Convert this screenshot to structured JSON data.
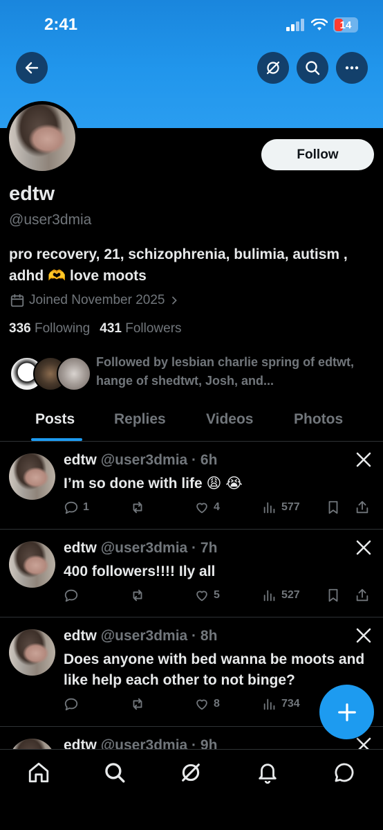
{
  "status_bar": {
    "time": "2:41",
    "battery": "14"
  },
  "profile": {
    "name": "edtw",
    "handle": "@user3dmia",
    "bio": "pro recovery, 21, schizophrenia, bulimia, autism , adhd 🫶 love moots",
    "joined": "Joined November 2025",
    "following_count": "336",
    "following_label": "Following",
    "followers_count": "431",
    "followers_label": "Followers",
    "followed_by": "Followed by lesbian charlie spring of edtwt, hange of shedtwt, Josh, and...",
    "follow_label": "Follow"
  },
  "tabs": [
    {
      "label": "Posts",
      "active": true
    },
    {
      "label": "Replies",
      "active": false
    },
    {
      "label": "Videos",
      "active": false
    },
    {
      "label": "Photos",
      "active": false
    }
  ],
  "posts": [
    {
      "name": "edtw",
      "handle": "@user3dmia",
      "time": "6h",
      "text": "I’m so done with life 😩 😭",
      "replies": "1",
      "reposts": "",
      "likes": "4",
      "views": "577"
    },
    {
      "name": "edtw",
      "handle": "@user3dmia",
      "time": "7h",
      "text": "400 followers!!!! Ily all",
      "replies": "",
      "reposts": "",
      "likes": "5",
      "views": "527"
    },
    {
      "name": "edtw",
      "handle": "@user3dmia",
      "time": "8h",
      "text": "Does anyone with bed wanna be moots and like help each other to not binge?",
      "replies": "",
      "reposts": "",
      "likes": "8",
      "views": "734"
    },
    {
      "name": "edtw",
      "handle": "@user3dmia",
      "time": "9h"
    }
  ],
  "colors": {
    "accent": "#1d9bf0",
    "banner": "#2196ec",
    "background": "#000000",
    "secondary_text": "#71767b"
  },
  "icons": {
    "back": "arrow-left-icon",
    "grok": "grok-icon",
    "search": "search-icon",
    "more": "more-icon",
    "calendar": "calendar-icon",
    "chevron": "chevron-right-icon",
    "x_logo": "x-logo-icon",
    "reply": "reply-icon",
    "repost": "repost-icon",
    "like": "heart-icon",
    "views": "views-icon",
    "bookmark": "bookmark-icon",
    "share": "share-icon",
    "compose": "plus-icon",
    "nav": [
      "home-icon",
      "search-icon",
      "grok-icon",
      "notifications-icon",
      "messages-icon"
    ]
  }
}
